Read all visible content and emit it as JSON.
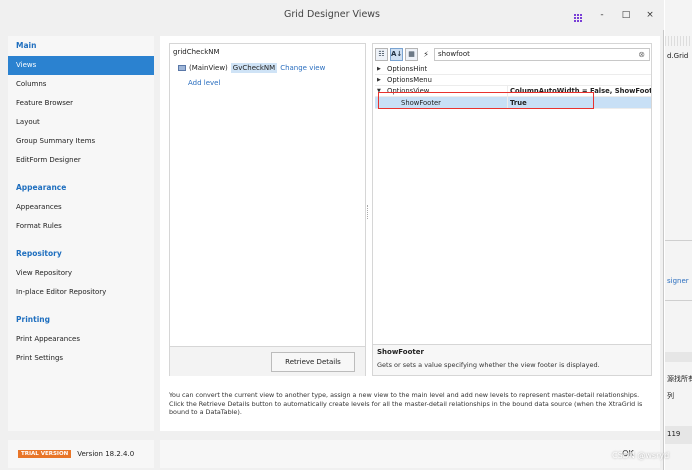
{
  "window": {
    "title": "Grid Designer Views",
    "controls": {
      "help": "-",
      "minimize": "□",
      "close": "×"
    }
  },
  "sidebar": {
    "groups": [
      {
        "title": "Main",
        "items": [
          "Views",
          "Columns",
          "Feature Browser",
          "Layout",
          "Group Summary Items",
          "EditForm Designer"
        ]
      },
      {
        "title": "Appearance",
        "items": [
          "Appearances",
          "Format Rules"
        ]
      },
      {
        "title": "Repository",
        "items": [
          "View Repository",
          "In-place Editor Repository"
        ]
      },
      {
        "title": "Printing",
        "items": [
          "Print Appearances",
          "Print Settings"
        ]
      }
    ],
    "selected": "Views",
    "trial_badge": "TRIAL VERSION",
    "version": "Version 18.2.4.0"
  },
  "levels": {
    "root": "gridCheckNM",
    "main_view_label": "(MainView)",
    "view_name": "GvCheckNM",
    "change_view": "Change view",
    "add_level": "Add level",
    "retrieve_button": "Retrieve Details"
  },
  "properties": {
    "toolbar": {
      "categorized": "☷",
      "alphabetical": "A↓",
      "events": "⚡"
    },
    "search_value": "showfoot",
    "search_clear": "⊗",
    "rows": [
      {
        "name": "OptionsHint",
        "value": "",
        "expanded": false
      },
      {
        "name": "OptionsMenu",
        "value": "",
        "expanded": false
      },
      {
        "name": "OptionsView",
        "value": "ColumnAutoWidth = False, ShowFooter",
        "expanded": true
      }
    ],
    "selected_row": {
      "name": "ShowFooter",
      "value": "True"
    },
    "description_title": "ShowFooter",
    "description_text": "Gets or sets a value specifying whether the view footer is displayed."
  },
  "info": {
    "line1": "You can convert the current view to another type, assign a new view to the main level and add new levels to represent master-detail relationships.",
    "line2": "Click the Retrieve Details button to automatically create levels for all the master-detail relationships in the bound data source (when the XtraGrid is",
    "line3": "bound to a DataTable)."
  },
  "ok_button": "OK",
  "background": {
    "text1": "d.Grid",
    "link": "signer",
    "text2": "源找所有",
    "text3": "列",
    "text4": "119"
  },
  "watermark": "CSDN @wsryd",
  "colors": {
    "accent": "#2b82d0",
    "group_title": "#1f6fbf",
    "highlight": "#e8322e",
    "trial": "#e87528"
  }
}
